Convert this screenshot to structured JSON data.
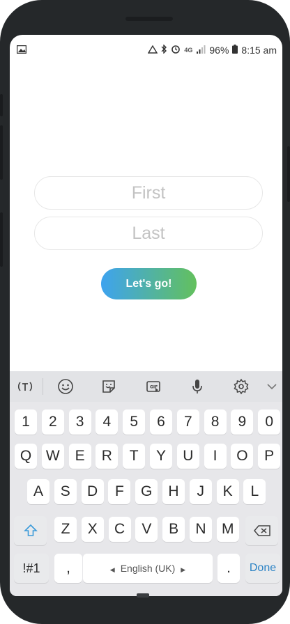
{
  "status": {
    "left_icon": "image-icon",
    "battery": "96%",
    "time": "8:15 am",
    "network": "4G"
  },
  "form": {
    "first_placeholder": "First",
    "last_placeholder": "Last",
    "submit_label": "Let's go!"
  },
  "keyboard": {
    "toolbar": [
      "text-mode-icon",
      "emoji-icon",
      "sticker-icon",
      "gif-icon",
      "mic-icon",
      "settings-icon",
      "chevron-down-icon"
    ],
    "gif_label": "GIF",
    "row_numbers": [
      "1",
      "2",
      "3",
      "4",
      "5",
      "6",
      "7",
      "8",
      "9",
      "0"
    ],
    "row_q": [
      "Q",
      "W",
      "E",
      "R",
      "T",
      "Y",
      "U",
      "I",
      "O",
      "P"
    ],
    "row_a": [
      "A",
      "S",
      "D",
      "F",
      "G",
      "H",
      "J",
      "K",
      "L"
    ],
    "row_z": [
      "Z",
      "X",
      "C",
      "V",
      "B",
      "N",
      "M"
    ],
    "symbols_label": "!#1",
    "comma_label": ",",
    "space_label": "English (UK)",
    "period_label": ".",
    "done_label": "Done"
  }
}
